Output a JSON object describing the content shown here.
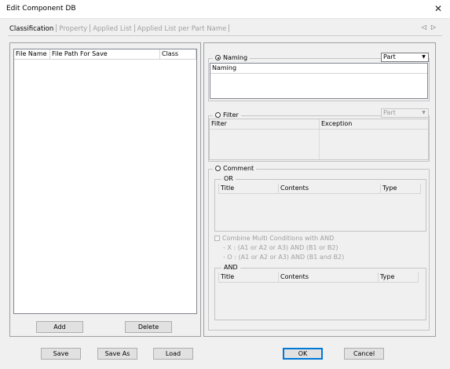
{
  "window": {
    "title": "Edit Component DB"
  },
  "tabs": [
    {
      "label": "Classification"
    },
    {
      "label": "Property"
    },
    {
      "label": "Applied List"
    },
    {
      "label": "Applied List per Part Name"
    }
  ],
  "left_list": {
    "columns": [
      "File Name",
      "File Path For Save",
      "Class"
    ],
    "add_label": "Add",
    "delete_label": "Delete"
  },
  "naming": {
    "radio_label": "Naming",
    "combo_value": "Part",
    "column": "Naming"
  },
  "filter": {
    "radio_label": "Filter",
    "combo_value": "Part",
    "columns": [
      "Filter",
      "Exception"
    ]
  },
  "comment": {
    "radio_label": "Comment",
    "or_group": {
      "label": "OR",
      "columns": [
        "Title",
        "Contents",
        "Type"
      ]
    },
    "combine_label": "Combine Multi Conditions with AND",
    "hint_x": "- X : (A1 or A2 or A3) AND (B1 or B2)",
    "hint_o": "- O : (A1 or A2 or A3) AND (B1 and B2)",
    "and_group": {
      "label": "AND",
      "columns": [
        "Title",
        "Contents",
        "Type"
      ]
    }
  },
  "footer": {
    "save_label": "Save",
    "save_as_label": "Save As",
    "load_label": "Load",
    "ok_label": "OK",
    "cancel_label": "Cancel"
  }
}
